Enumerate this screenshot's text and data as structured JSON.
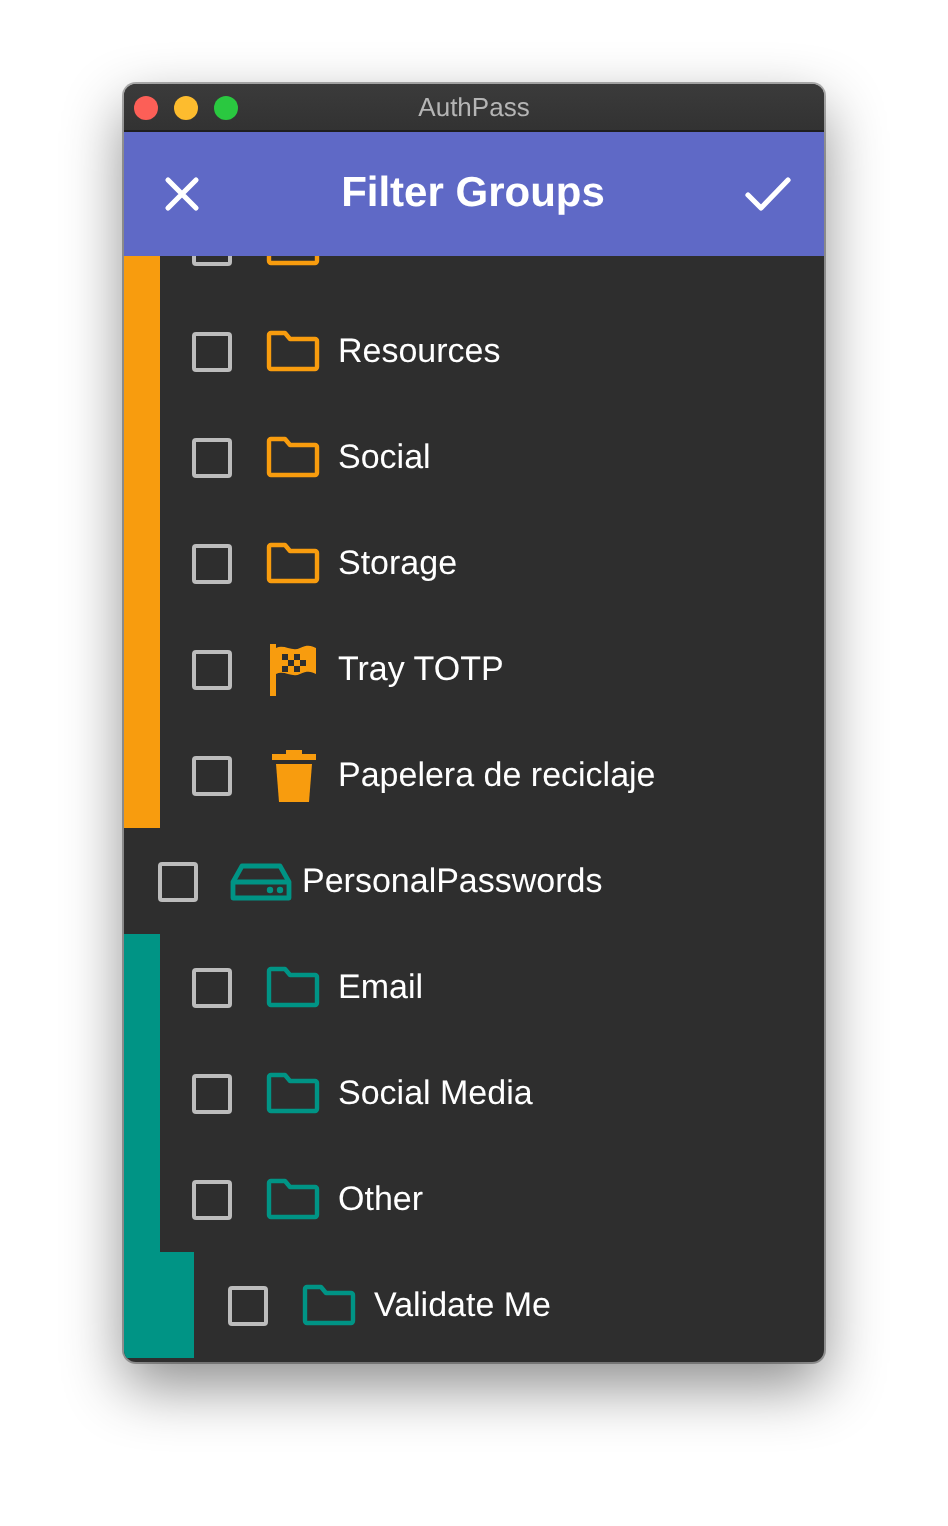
{
  "window": {
    "title": "AuthPass"
  },
  "app_bar": {
    "title": "Filter Groups"
  },
  "databases": [
    {
      "color": "#f89c0e",
      "items": [
        {
          "kind": "folder",
          "checked": false
        },
        {
          "label": "Resources",
          "kind": "folder",
          "checked": false
        },
        {
          "label": "Social",
          "kind": "folder",
          "checked": false
        },
        {
          "label": "Storage",
          "kind": "folder",
          "checked": false
        },
        {
          "label": "Tray TOTP",
          "kind": "flag",
          "checked": false
        },
        {
          "label": "Papelera de reciclaje",
          "kind": "trash",
          "checked": false
        }
      ]
    },
    {
      "name": "PersonalPasswords",
      "color": "#009485",
      "checked": false,
      "items": [
        {
          "label": "Email",
          "kind": "folder",
          "checked": false
        },
        {
          "label": "Social Media",
          "kind": "folder",
          "checked": false
        },
        {
          "label": "Other",
          "kind": "folder",
          "checked": false,
          "children": [
            {
              "label": "Validate Me",
              "kind": "folder",
              "checked": false
            }
          ]
        }
      ]
    }
  ]
}
